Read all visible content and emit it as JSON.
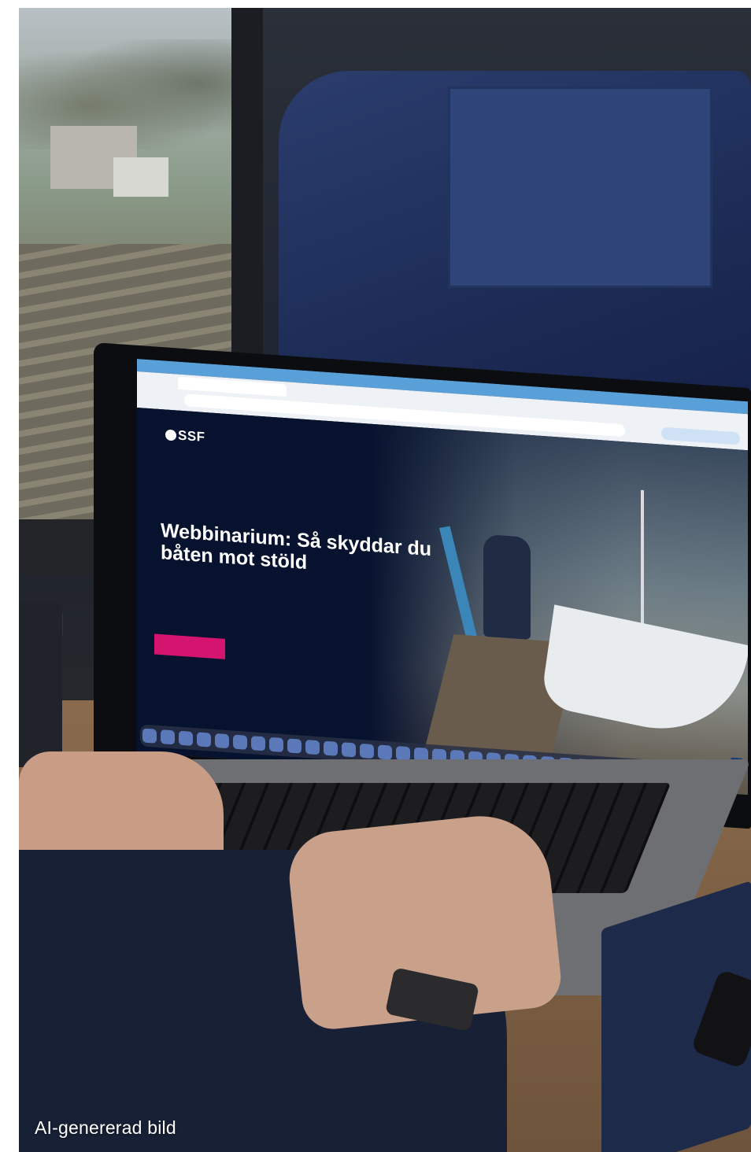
{
  "caption": "AI-genererad bild",
  "screen": {
    "site_logo": "SSF",
    "hero_title_line1": "Webbinarium: Så skyddar du",
    "hero_title_line2": "båten mot stöld",
    "accent_color": "#d4146e",
    "brand_color": "#07122e"
  }
}
